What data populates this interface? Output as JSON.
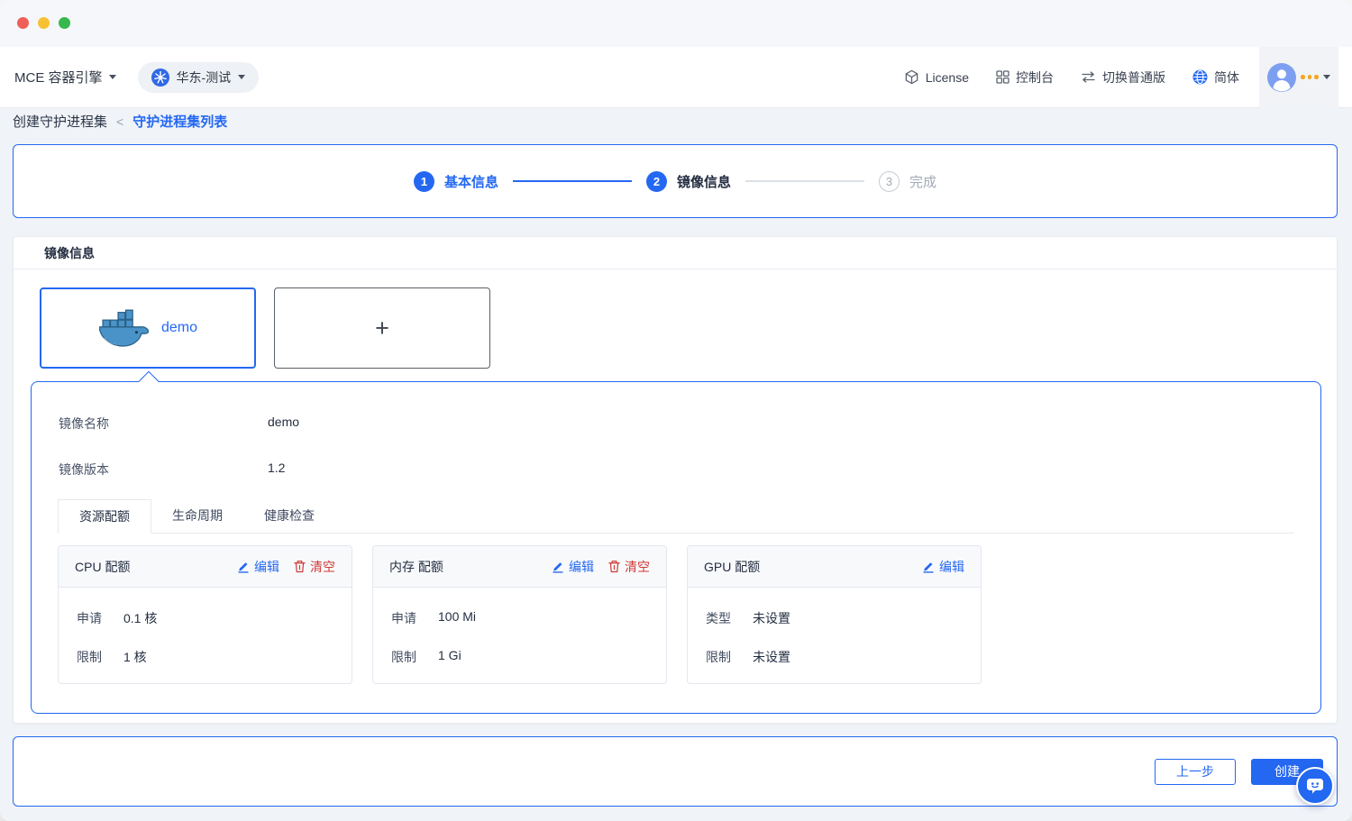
{
  "header": {
    "product_label": "MCE 容器引擎",
    "region_label": "华东-测试",
    "nav": [
      {
        "label": "License",
        "icon": "license-cube-icon"
      },
      {
        "label": "控制台",
        "icon": "console-grid-icon"
      },
      {
        "label": "切换普通版",
        "icon": "switch-arrows-icon"
      },
      {
        "label": "简体",
        "icon": "globe-icon"
      }
    ]
  },
  "breadcrumb": {
    "current": "创建守护进程集",
    "separator": "<",
    "link": "守护进程集列表"
  },
  "stepper": {
    "steps": [
      {
        "num": "1",
        "label": "基本信息",
        "state": "done"
      },
      {
        "num": "2",
        "label": "镜像信息",
        "state": "active"
      },
      {
        "num": "3",
        "label": "完成",
        "state": "pending"
      }
    ]
  },
  "image_section": {
    "title": "镜像信息",
    "selected_image": {
      "name": "demo",
      "icon": "docker-whale-icon"
    },
    "add_label": "+",
    "fields": [
      {
        "label": "镜像名称",
        "value": "demo"
      },
      {
        "label": "镜像版本",
        "value": "1.2"
      }
    ],
    "tabs": [
      {
        "label": "资源配额",
        "active": true
      },
      {
        "label": "生命周期",
        "active": false
      },
      {
        "label": "健康检查",
        "active": false
      }
    ],
    "quota_cards": [
      {
        "title": "CPU 配额",
        "edit_label": "编辑",
        "clear_label": "清空",
        "rows": [
          {
            "label": "申请",
            "value": "0.1 核"
          },
          {
            "label": "限制",
            "value": "1 核"
          }
        ]
      },
      {
        "title": "内存 配额",
        "edit_label": "编辑",
        "clear_label": "清空",
        "rows": [
          {
            "label": "申请",
            "value": "100 Mi"
          },
          {
            "label": "限制",
            "value": "1 Gi"
          }
        ]
      },
      {
        "title": "GPU 配额",
        "edit_label": "编辑",
        "rows": [
          {
            "label": "类型",
            "value": "未设置"
          },
          {
            "label": "限制",
            "value": "未设置"
          }
        ]
      }
    ]
  },
  "footer": {
    "prev_label": "上一步",
    "create_label": "创建"
  },
  "colors": {
    "primary": "#2468f2",
    "danger": "#cf3a36",
    "accent_dots": "#f5a623",
    "avatar": "#7d9ff1"
  }
}
